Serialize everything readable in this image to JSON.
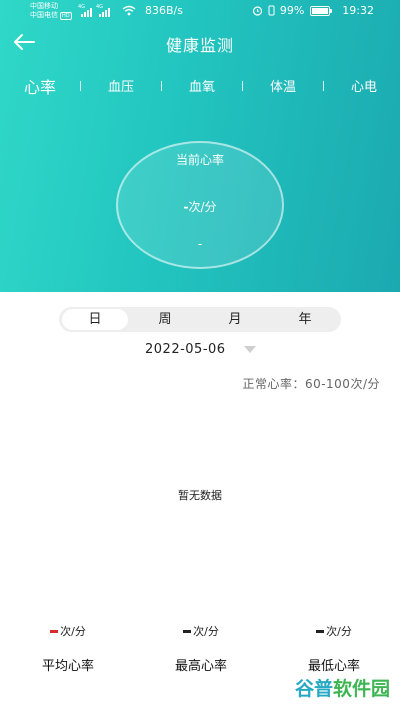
{
  "status_bar": {
    "carrier_1": "中国移动",
    "carrier_2": "中国电信",
    "hd_badge": "HD",
    "signal_1_label": "4G",
    "signal_2_label": "4G",
    "net_speed": "836B/s",
    "battery_percent": "99%",
    "battery_level": 0.99,
    "time": "19:32",
    "icons": [
      "signal-icon",
      "wifi-icon",
      "alarm-icon",
      "vibrate-icon",
      "battery-icon"
    ]
  },
  "header": {
    "back_icon": "arrow-left-icon",
    "title": "健康监测"
  },
  "tabs": [
    {
      "label": "心率",
      "active": true
    },
    {
      "label": "血压",
      "active": false
    },
    {
      "label": "血氧",
      "active": false
    },
    {
      "label": "体温",
      "active": false
    },
    {
      "label": "心电",
      "active": false
    }
  ],
  "gauge": {
    "title": "当前心率",
    "value": "-",
    "unit": "次/分",
    "sub_value": "-"
  },
  "period_selector": {
    "options": [
      "日",
      "周",
      "月",
      "年"
    ],
    "selected": "日"
  },
  "date": {
    "value": "2022-05-06",
    "caret_icon": "triangle-down-icon"
  },
  "normal_range": "正常心率：60-100次/分",
  "empty_text": "暂无数据",
  "stats": [
    {
      "value": "-",
      "unit": "次/分",
      "label": "平均心率",
      "accent": "#d72b2b"
    },
    {
      "value": "-",
      "unit": "次/分",
      "label": "最高心率",
      "accent": "#222222"
    },
    {
      "value": "-",
      "unit": "次/分",
      "label": "最低心率",
      "accent": "#222222"
    }
  ],
  "watermark": {
    "part_1": "谷普",
    "part_2": "软件园"
  },
  "colors": {
    "header_start": "#2fd8c8",
    "header_end": "#1ba9b0",
    "accent_red": "#d72b2b"
  }
}
